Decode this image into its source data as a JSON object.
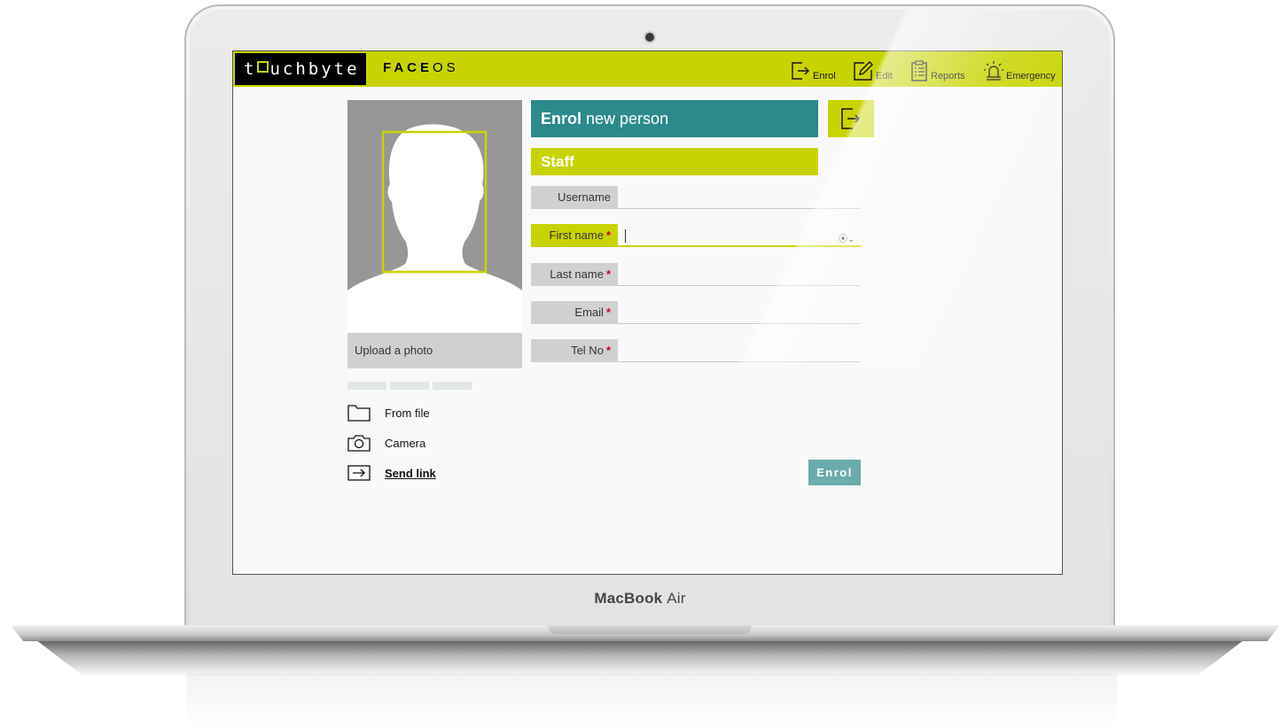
{
  "device": {
    "brand": "MacBook",
    "model": "Air"
  },
  "app": {
    "logo_text": [
      "t",
      "uchbyte"
    ],
    "name_bold": "FACE",
    "name_regular": "OS"
  },
  "nav": [
    {
      "label": "Enrol",
      "icon": "enrol-icon"
    },
    {
      "label": "Edit",
      "icon": "edit-icon"
    },
    {
      "label": "Reports",
      "icon": "reports-icon"
    },
    {
      "label": "Emergency",
      "icon": "emergency-icon"
    }
  ],
  "form": {
    "title_bold": "Enrol",
    "title_rest": " new person",
    "section": "Staff",
    "fields": [
      {
        "label": "Username",
        "required": false,
        "value": ""
      },
      {
        "label": "First name",
        "required": true,
        "value": ""
      },
      {
        "label": "Last name",
        "required": true,
        "value": ""
      },
      {
        "label": "Email",
        "required": true,
        "value": ""
      },
      {
        "label": "Tel No",
        "required": true,
        "value": ""
      }
    ],
    "required_mark": "*",
    "autofill_icon": "⦿⌄",
    "submit_label": "Enrol"
  },
  "photo": {
    "upload_label": "Upload a photo",
    "sources": [
      {
        "label": "From file",
        "icon": "folder-icon"
      },
      {
        "label": "Camera",
        "icon": "camera-icon"
      },
      {
        "label": "Send link",
        "icon": "send-link-icon"
      }
    ]
  },
  "colors": {
    "accent": "#c8d400",
    "teal": "#2c8a8c",
    "submit": "#6aabab",
    "required": "#d0021b"
  }
}
